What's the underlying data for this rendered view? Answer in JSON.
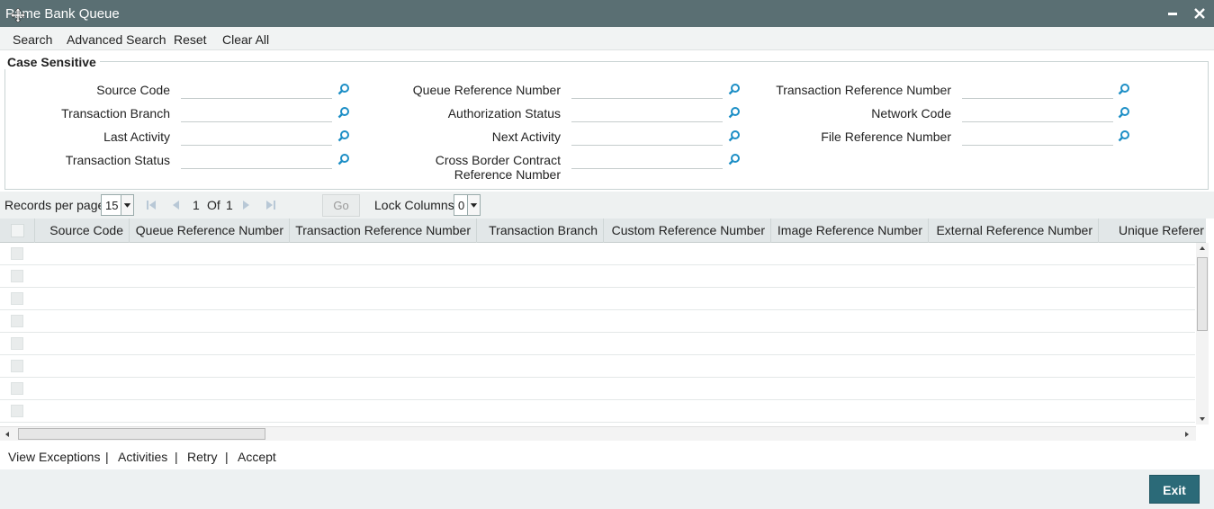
{
  "window": {
    "title": "Pame Bank Queue"
  },
  "menu": {
    "search": "Search",
    "advanced_search": "Advanced Search",
    "reset": "Reset",
    "clear_all": "Clear All"
  },
  "criteria": {
    "legend": "Case Sensitive",
    "source_code": "Source Code",
    "transaction_branch": "Transaction Branch",
    "last_activity": "Last Activity",
    "transaction_status": "Transaction Status",
    "queue_reference_number": "Queue Reference Number",
    "authorization_status": "Authorization Status",
    "next_activity": "Next Activity",
    "cross_border_line1": "Cross Border Contract",
    "cross_border_line2": "Reference Number",
    "transaction_reference_number": "Transaction Reference Number",
    "network_code": "Network Code",
    "file_reference_number": "File Reference Number"
  },
  "pager": {
    "records_label": "Records per page",
    "records_value": "15",
    "page_current": "1",
    "of_label": "Of",
    "page_total": "1",
    "go_label": "Go",
    "lock_label": "Lock Columns",
    "lock_value": "0"
  },
  "grid": {
    "columns": [
      "Source Code",
      "Queue Reference Number",
      "Transaction Reference Number",
      "Transaction Branch",
      "Custom Reference Number",
      "Image Reference Number",
      "External Reference Number",
      "Unique Referer"
    ]
  },
  "actions": {
    "view_exceptions": "View Exceptions",
    "sep": "|",
    "activities": "Activities",
    "retry": "Retry",
    "accept": "Accept"
  },
  "footer": {
    "exit": "Exit"
  },
  "colors": {
    "titlebar": "#5a6f73",
    "accent": "#2b6a78",
    "lens": "#1e8fc6"
  }
}
